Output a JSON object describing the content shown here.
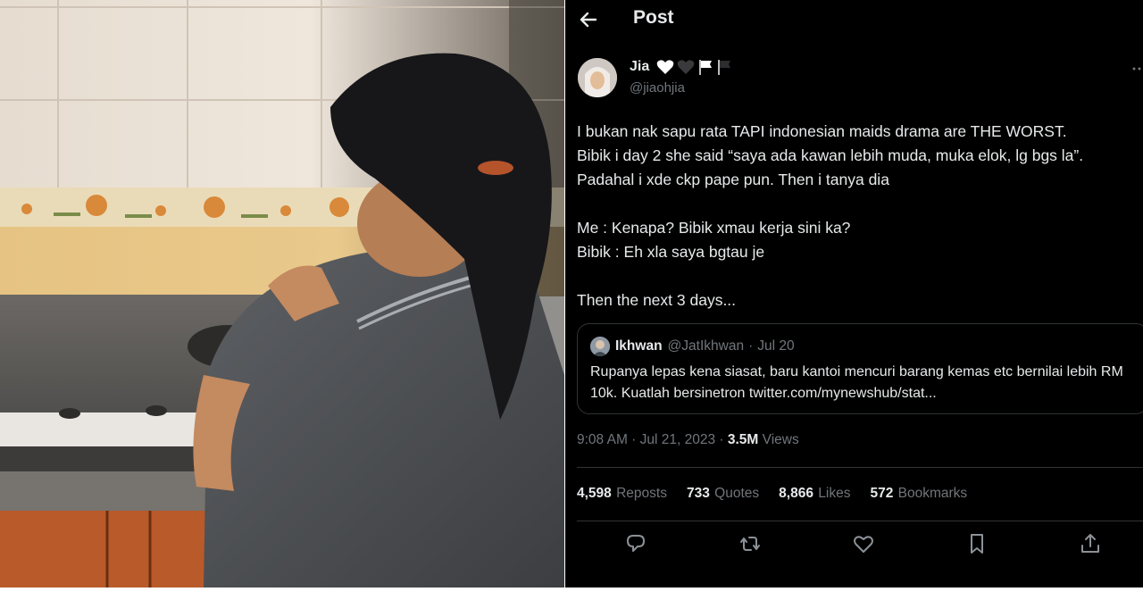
{
  "header": {
    "title": "Post",
    "back_icon": "arrow-left-icon"
  },
  "author": {
    "name": "Jia",
    "name_emojis": [
      "white-heart-emoji",
      "black-heart-emoji",
      "white-flag-emoji",
      "black-flag-emoji"
    ],
    "handle": "@jiaohjia",
    "more_icon": "more-dots-icon"
  },
  "tweet": {
    "text": "I bukan nak sapu rata TAPI indonesian maids drama are THE WORST.\nBibik i day 2 she said “saya ada kawan lebih muda, muka elok, lg bgs la”.\nPadahal i xde ckp pape pun. Then i tanya dia\n\nMe : Kenapa? Bibik xmau kerja sini ka?\nBibik : Eh xla saya bgtau je\n\nThen the next 3 days..."
  },
  "quote": {
    "name": "Ikhwan",
    "handle": "@JatIkhwan",
    "separator": "·",
    "date": "Jul 20",
    "text": "Rupanya lepas kena siasat, baru kantoi mencuri barang kemas etc bernilai lebih RM 10k. Kuatlah bersinetron twitter.com/mynewshub/stat..."
  },
  "meta": {
    "time": "9:08 AM · Jul 21, 2023 · ",
    "views_count": "3.5M",
    "views_label": " Views"
  },
  "stats": [
    {
      "count": "4,598",
      "label": "Reposts"
    },
    {
      "count": "733",
      "label": "Quotes"
    },
    {
      "count": "8,866",
      "label": "Likes"
    },
    {
      "count": "572",
      "label": "Bookmarks"
    }
  ],
  "actions": [
    "reply-icon",
    "repost-icon",
    "like-icon",
    "bookmark-icon",
    "share-icon"
  ],
  "colors": {
    "background": "#000000",
    "text": "#e7e9ea",
    "secondary": "#71767b",
    "border": "#2f3336"
  }
}
